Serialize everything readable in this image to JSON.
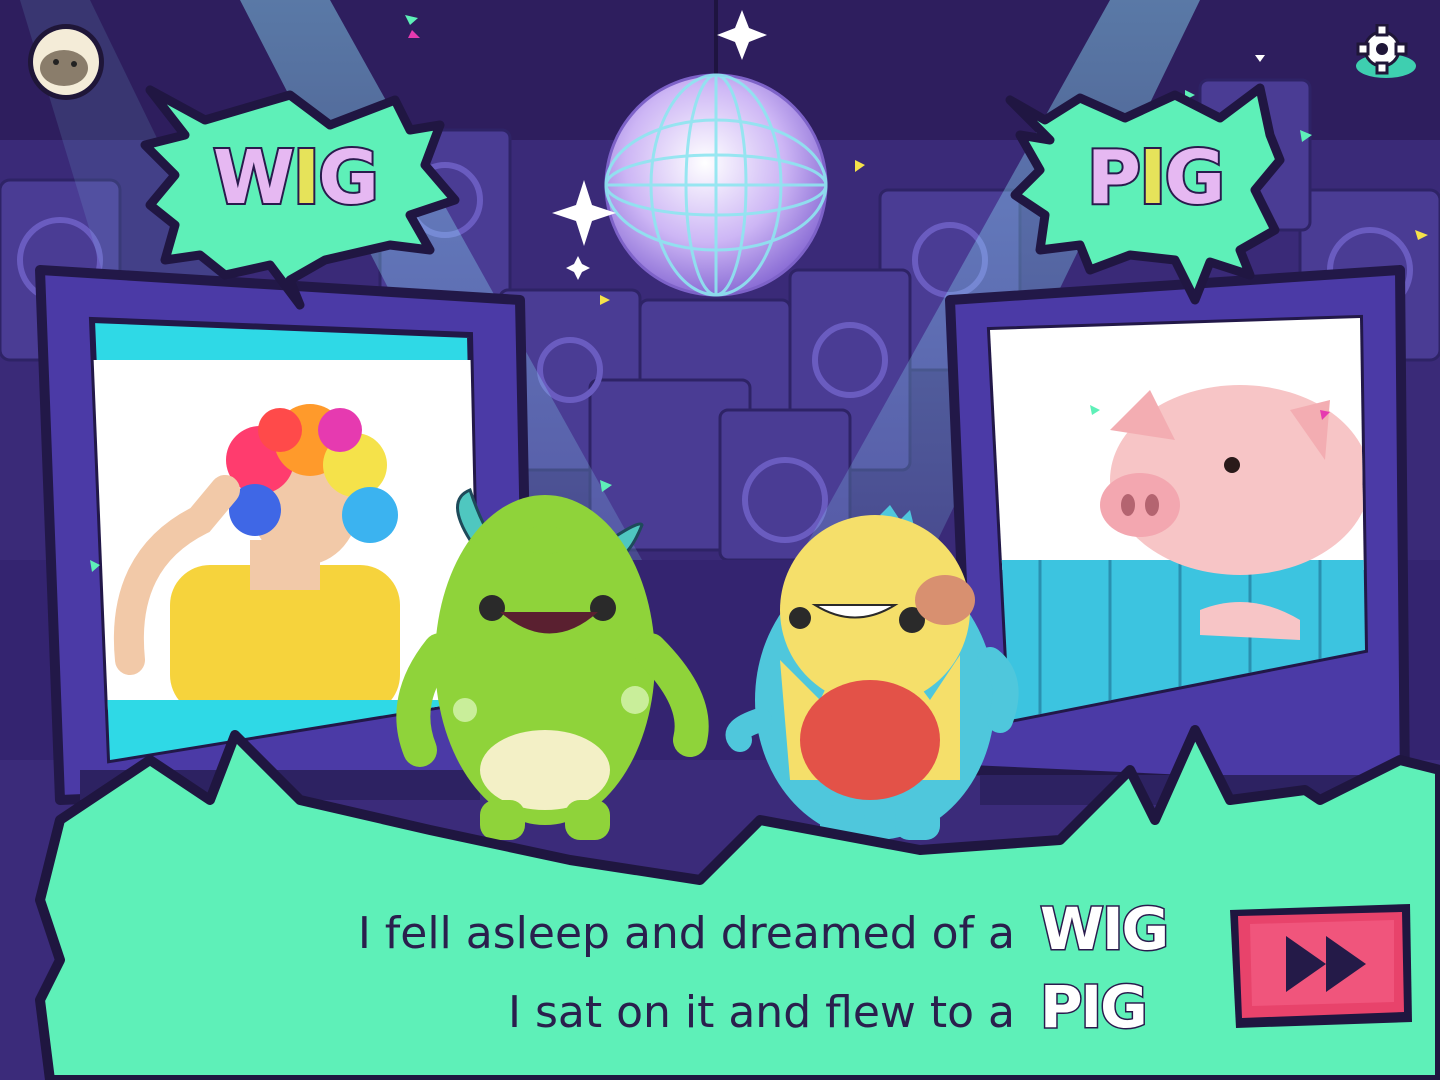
{
  "top_bar": {
    "avatar_icon": "hedgehog-avatar-icon",
    "settings_icon": "gear-icon"
  },
  "bubbles": {
    "left": {
      "word_start": "W",
      "word_highlight": "I",
      "word_end": "G"
    },
    "right": {
      "word_start": "P",
      "word_highlight": "I",
      "word_end": "G"
    }
  },
  "screens": {
    "left_image": "boy-in-rainbow-wig",
    "right_image": "piglet-on-blue-fence"
  },
  "characters": [
    "green-monster",
    "yellow-blue-monster"
  ],
  "caption": {
    "line1_text": "I fell asleep and dreamed of a",
    "line1_word": "WIG",
    "line2_text": "I sat on it and flew to a",
    "line2_word": "PIG"
  },
  "controls": {
    "next_icon": "fast-forward-icon"
  },
  "colors": {
    "background": "#2d1d5c",
    "bubble": "#5ef0b8",
    "word_fill": "#e6b8f2",
    "word_highlight": "#e6e35a",
    "next_button": "#e8436b",
    "text_dark": "#2a1f4d"
  }
}
